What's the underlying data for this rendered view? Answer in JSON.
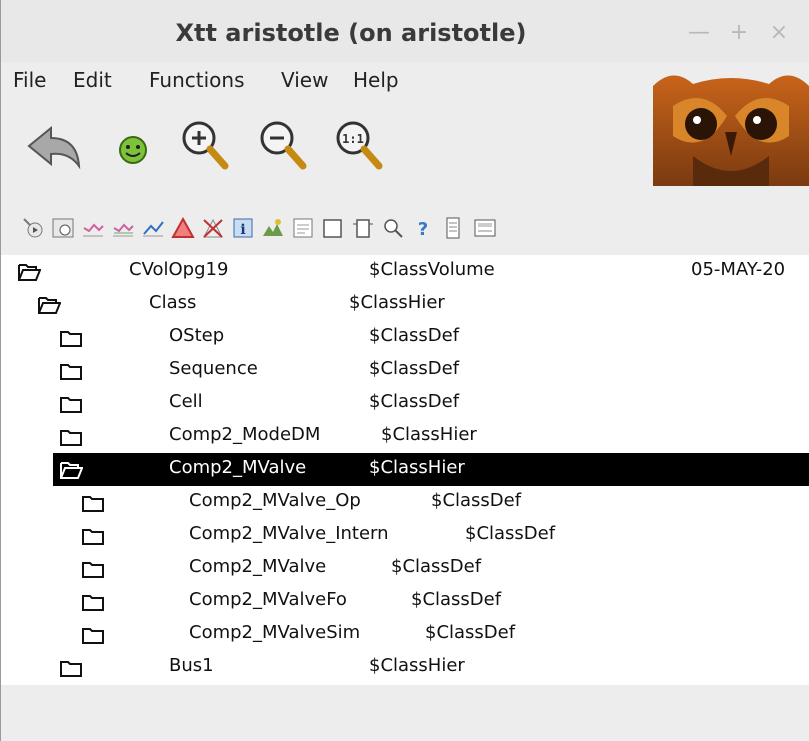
{
  "window": {
    "title": "Xtt aristotle (on aristotle)",
    "buttons": {
      "minimize": "—",
      "maximize": "+",
      "close": "×"
    }
  },
  "menu": {
    "items": [
      "File",
      "Edit",
      "Functions",
      "View",
      "Help"
    ]
  },
  "toolbar_main": [
    {
      "name": "back-arrow-icon"
    },
    {
      "name": "smiley-icon"
    },
    {
      "name": "zoom-in-icon"
    },
    {
      "name": "zoom-out-icon"
    },
    {
      "name": "zoom-reset-icon"
    }
  ],
  "toolbar_small": [
    "open-object-icon",
    "open-graph-icon",
    "trend-icon",
    "fast-curve-icon",
    "history-icon",
    "alarm-icon",
    "block-events-icon",
    "info-icon",
    "crossreferences-icon",
    "open-plc-icon",
    "collapse-icon",
    "expand-icon",
    "zoom-object-icon",
    "help-icon",
    "notes-icon",
    "class-graph-icon"
  ],
  "colors": {
    "selected_bg": "#000000",
    "owl_orange": "#e07a1a",
    "owl_dark": "#6b3410"
  },
  "tree": [
    {
      "name": "CVolOpg19",
      "cls": "$ClassVolume",
      "date": "05-MAY-20",
      "open": true,
      "selected": false
    },
    {
      "name": "Class",
      "cls": "$ClassHier",
      "open": true,
      "selected": false
    },
    {
      "name": "OStep",
      "cls": "$ClassDef",
      "open": false,
      "selected": false
    },
    {
      "name": "Sequence",
      "cls": "$ClassDef",
      "open": false,
      "selected": false
    },
    {
      "name": "Cell",
      "cls": "$ClassDef",
      "open": false,
      "selected": false
    },
    {
      "name": "Comp2_ModeDM",
      "cls": "$ClassHier",
      "open": false,
      "selected": false
    },
    {
      "name": "Comp2_MValve",
      "cls": "$ClassHier",
      "open": true,
      "selected": true
    },
    {
      "name": "Comp2_MValve_Op",
      "cls": "$ClassDef",
      "open": false,
      "selected": false
    },
    {
      "name": "Comp2_MValve_Intern",
      "cls": "$ClassDef",
      "open": false,
      "selected": false
    },
    {
      "name": "Comp2_MValve",
      "cls": "$ClassDef",
      "open": false,
      "selected": false
    },
    {
      "name": "Comp2_MValveFo",
      "cls": "$ClassDef",
      "open": false,
      "selected": false
    },
    {
      "name": "Comp2_MValveSim",
      "cls": "$ClassDef",
      "open": false,
      "selected": false
    },
    {
      "name": "Bus1",
      "cls": "$ClassHier",
      "open": false,
      "selected": false
    }
  ]
}
